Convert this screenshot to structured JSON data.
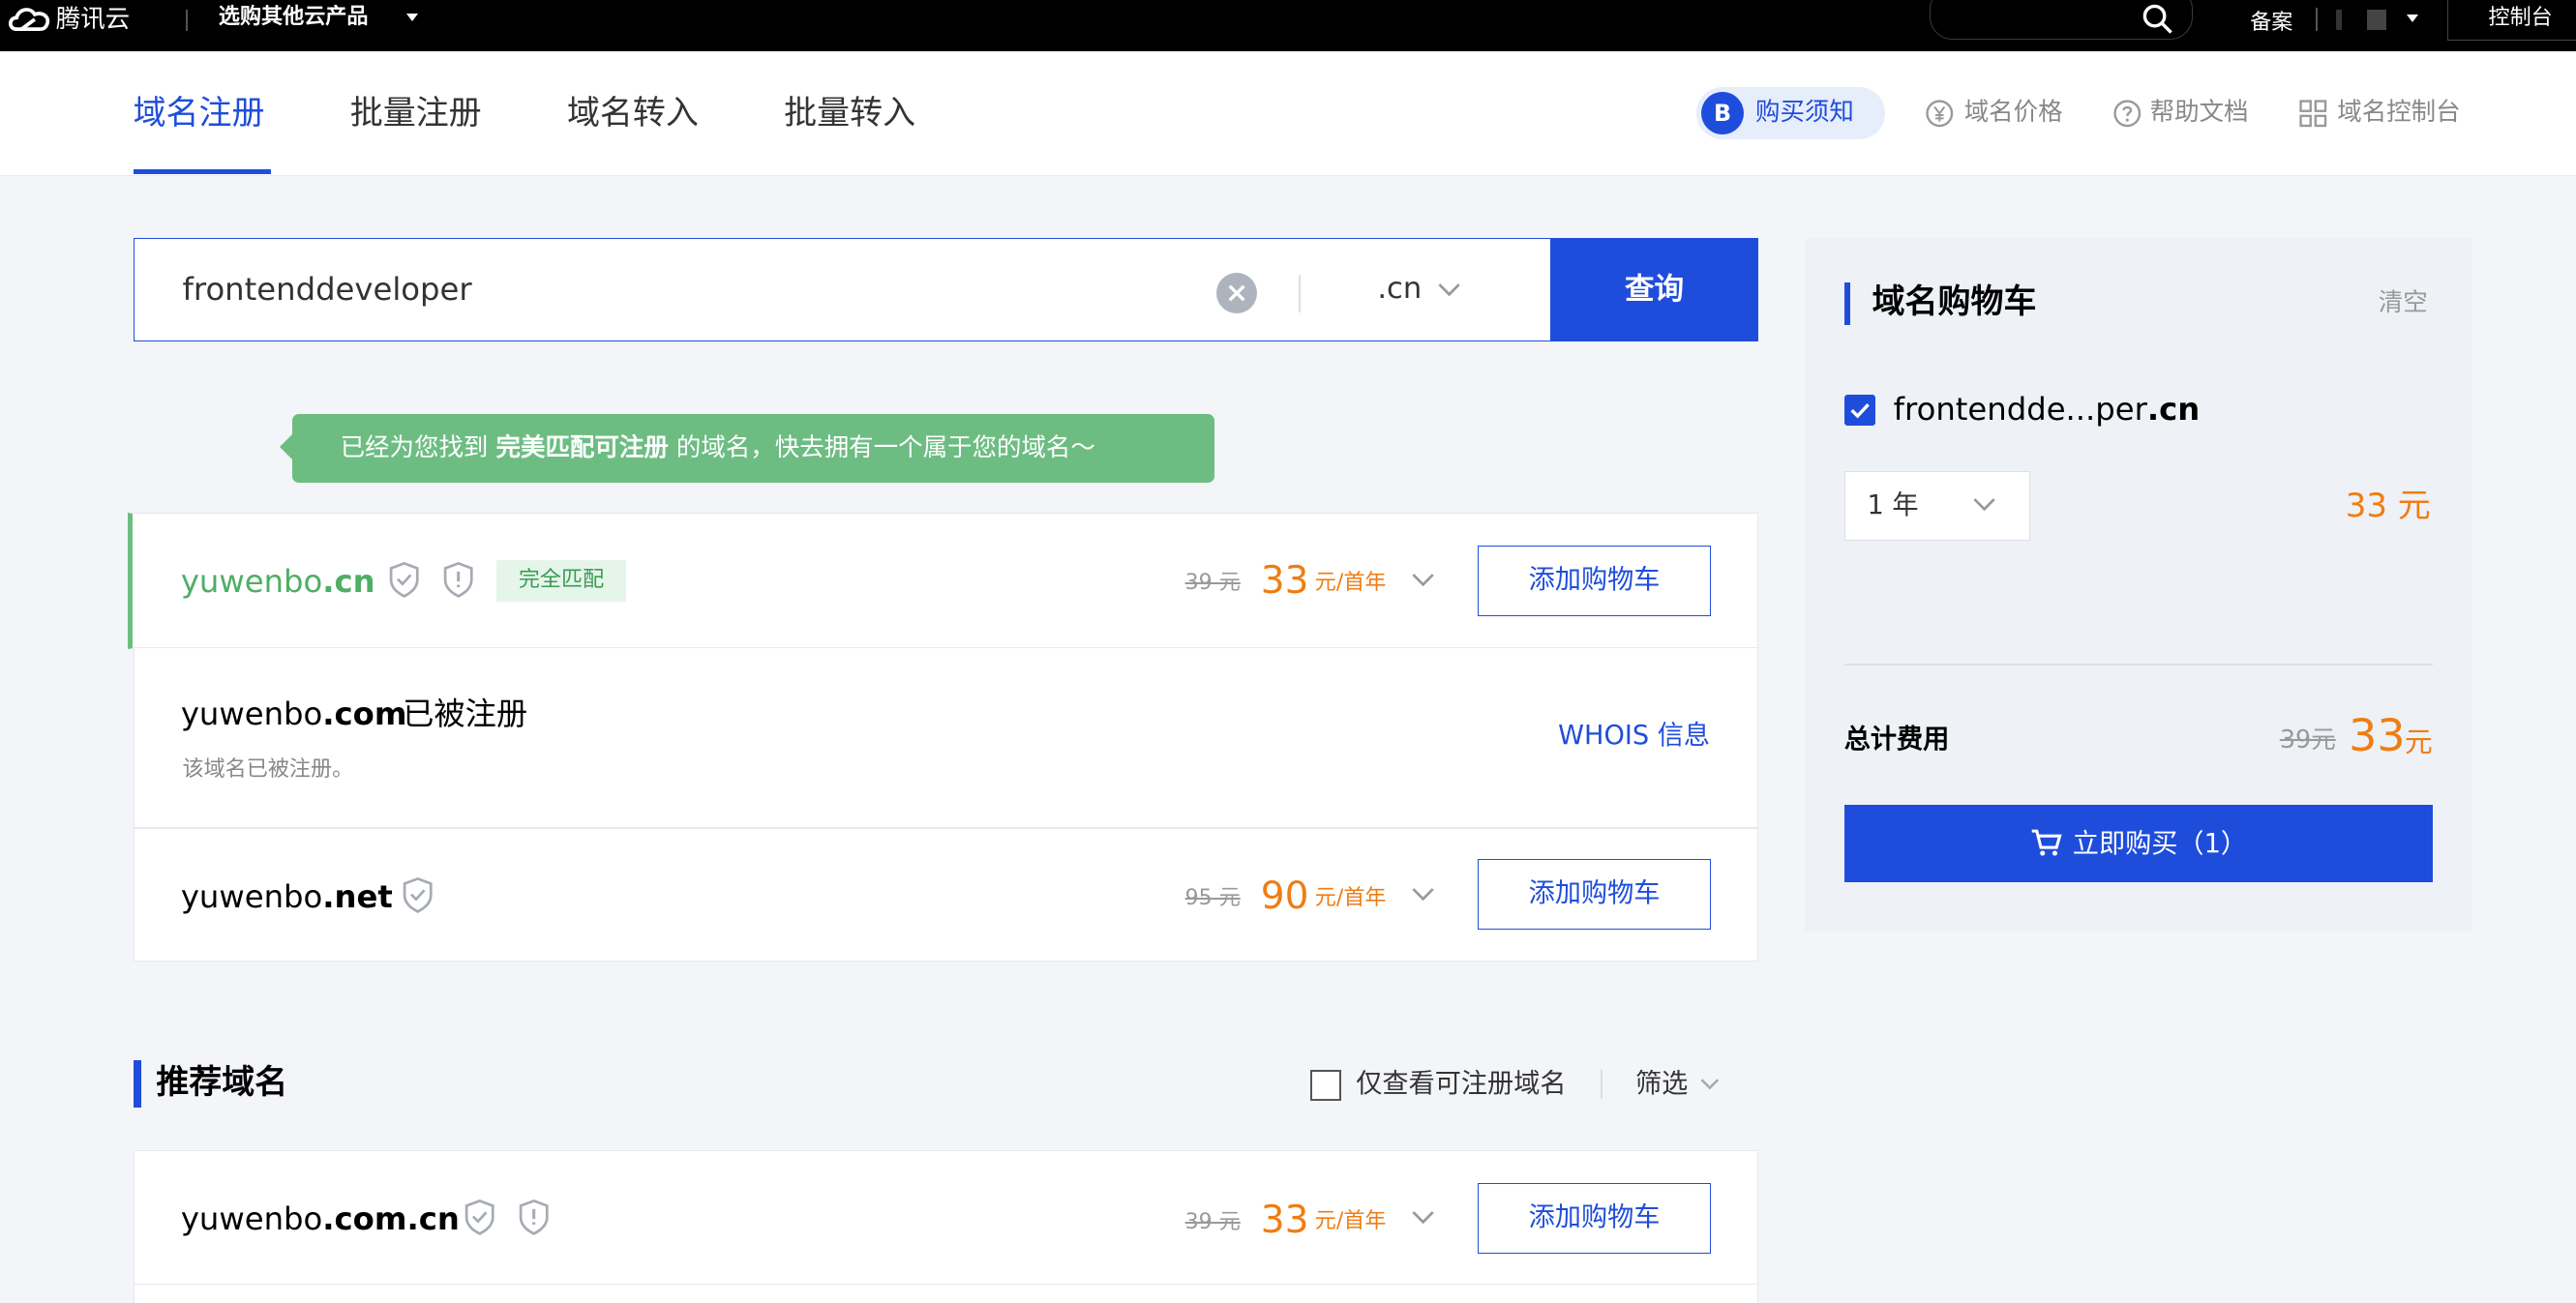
{
  "topbar": {
    "brand": "腾讯云",
    "product_menu": "选购其他云产品",
    "beian": "备案",
    "console": "控制台"
  },
  "nav": {
    "tabs": [
      "域名注册",
      "批量注册",
      "域名转入",
      "批量转入"
    ],
    "active_tab": "域名注册",
    "notice": "购买须知",
    "notice_icon": "B",
    "links": [
      "域名价格",
      "帮助文档",
      "域名控制台"
    ]
  },
  "search": {
    "value": "frontenddeveloper",
    "clear_icon": "×",
    "suffix": ".cn",
    "button": "查询"
  },
  "tip": {
    "prefix": "已经为您找到 ",
    "highlight": "完美匹配可注册",
    "suffix": " 的域名，快去拥有一个属于您的域名～"
  },
  "results": [
    {
      "name": "yuwenbo",
      "tld": ".cn",
      "badge": "完全匹配",
      "orig_price": "39 元",
      "price": "33",
      "unit": "元/首年",
      "button": "添加购物车"
    },
    {
      "name": "yuwenbo",
      "tld": ".com",
      "status": "已被注册",
      "note": "该域名已被注册。",
      "link": "WHOIS 信息"
    },
    {
      "name": "yuwenbo",
      "tld": ".net",
      "orig_price": "95 元",
      "price": "90",
      "unit": "元/首年",
      "button": "添加购物车"
    }
  ],
  "recommend": {
    "title": "推荐域名",
    "checkbox_label": "仅查看可注册域名",
    "filter": "筛选",
    "items": [
      {
        "name": "yuwenbo",
        "tld": ".com.cn",
        "orig_price": "39 元",
        "price": "33",
        "unit": "元/首年",
        "button": "添加购物车"
      }
    ]
  },
  "cart": {
    "title": "域名购物车",
    "clear": "清空",
    "item_name": "frontendde...per",
    "item_tld": ".cn",
    "period": "1 年",
    "item_price": "33 元",
    "total_label": "总计费用",
    "total_orig": "39元",
    "total_price": "33",
    "total_unit": "元",
    "buy_button": "立即购买（1）"
  },
  "colors": {
    "primary": "#1f4ddb",
    "price": "#ef7d13",
    "match_green": "#4fae66",
    "tip_green": "#6dbd83"
  }
}
